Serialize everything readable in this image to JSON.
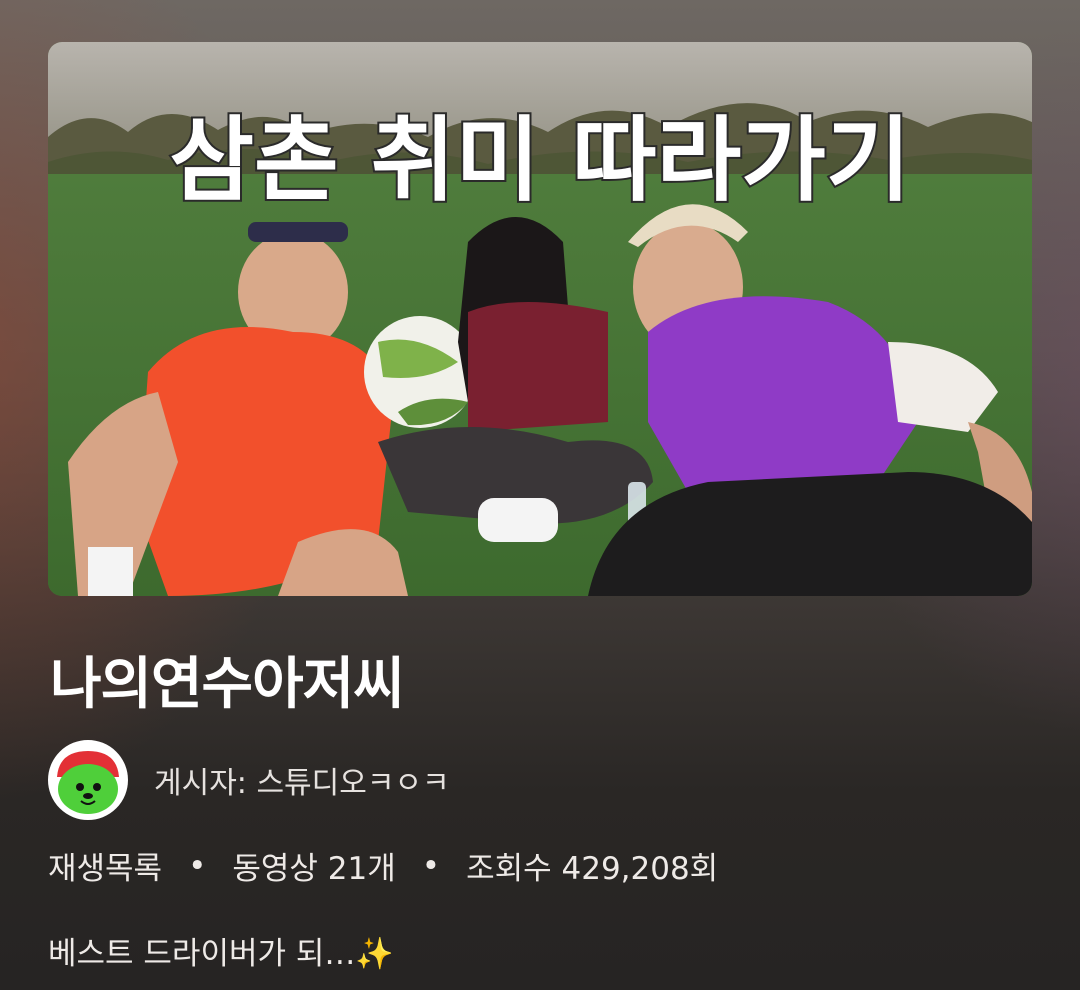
{
  "playlist": {
    "title": "나의연수아저씨",
    "thumbnail_text": "삼촌 취미 따라가기",
    "author": "게시자: 스튜디오ㅋㅇㅋ",
    "meta": {
      "type": "재생목록",
      "video_count": "동영상 21개",
      "views": "조회수 429,208회",
      "separator": "•"
    },
    "description": "베스트 드라이버가 되…✨"
  },
  "colors": {
    "text": "#ffffff",
    "secondary_text": "#e6e2df"
  }
}
